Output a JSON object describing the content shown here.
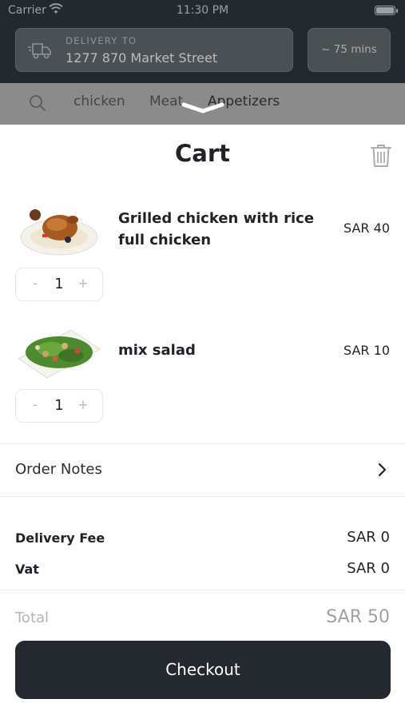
{
  "status_bar": {
    "carrier": "Carrier",
    "time": "11:30 PM"
  },
  "delivery": {
    "label": "DELIVERY TO",
    "address": "1277 870 Market Street",
    "eta": "~ 75 mins"
  },
  "categories": [
    "chicken",
    "Meat",
    "Appetizers"
  ],
  "cart": {
    "title": "Cart",
    "items": [
      {
        "name": "Grilled chicken with rice full chicken",
        "price": "SAR 40",
        "quantity": "1",
        "minus": "-",
        "plus": "+"
      },
      {
        "name": "mix salad",
        "price": "SAR 10",
        "quantity": "1",
        "minus": "-",
        "plus": "+"
      }
    ],
    "order_notes_label": "Order Notes",
    "fees": [
      {
        "label": "Delivery Fee",
        "value": "SAR 0"
      },
      {
        "label": "Vat",
        "value": "SAR 0"
      }
    ],
    "total_label": "Total",
    "total_value": "SAR 50",
    "checkout_label": "Checkout"
  },
  "icons": {
    "wifi": "wifi-icon",
    "battery": "battery-icon",
    "truck": "truck-icon",
    "search": "search-icon",
    "grabber": "sheet-grabber-icon",
    "trash": "trash-icon",
    "chevron": "chevron-right-icon"
  },
  "colors": {
    "dark": "#23292e",
    "text": "#1f2327",
    "muted": "#b3b6b9",
    "border": "#e6e8ea"
  }
}
